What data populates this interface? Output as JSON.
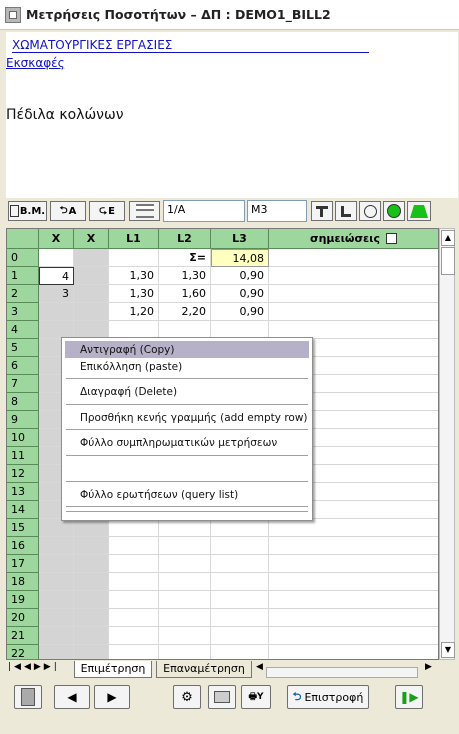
{
  "window": {
    "title": "Μετρήσεις Ποσοτήτων – ΔΠ : DEMO1_BILL2"
  },
  "info": {
    "category": "ΧΩΜΑΤΟΥΡΓΙΚΕΣ ΕΡΓΑΣΙΕΣ",
    "subcategory": "Εκσκαφές",
    "description": "Πέδιλα κολώνων"
  },
  "toolbar": {
    "bm_label": "B.M.",
    "a_label": "A",
    "e_label": "E",
    "code_value": "1/A",
    "unit_value": "M3"
  },
  "grid": {
    "columns": [
      "X",
      "X",
      "L1",
      "L2",
      "L3",
      "σημειώσεις"
    ],
    "sum_label": "Σ=",
    "sum_value": "14,08",
    "rows": [
      {
        "n": "0",
        "x1": "",
        "l1": "",
        "l2": "",
        "l3": ""
      },
      {
        "n": "1",
        "x1": "4",
        "l1": "1,30",
        "l2": "1,30",
        "l3": "0,90"
      },
      {
        "n": "2",
        "x1": "3",
        "l1": "1,30",
        "l2": "1,60",
        "l3": "0,90"
      },
      {
        "n": "3",
        "x1": "",
        "l1": "1,20",
        "l2": "2,20",
        "l3": "0,90"
      },
      {
        "n": "4"
      },
      {
        "n": "5"
      },
      {
        "n": "6"
      },
      {
        "n": "7"
      },
      {
        "n": "8"
      },
      {
        "n": "9"
      },
      {
        "n": "10"
      },
      {
        "n": "11"
      },
      {
        "n": "12"
      },
      {
        "n": "13"
      },
      {
        "n": "14"
      },
      {
        "n": "15"
      },
      {
        "n": "16"
      },
      {
        "n": "17"
      },
      {
        "n": "18"
      },
      {
        "n": "19"
      },
      {
        "n": "20"
      },
      {
        "n": "21"
      },
      {
        "n": "22"
      }
    ]
  },
  "context_menu": {
    "items": [
      "Αντιγραφή (Copy)",
      "Επικόλληση (paste)",
      "Διαγραφή (Delete)",
      "Προσθήκη κενής γραμμής (add empty row)",
      "Φύλλο συμπληρωματικών μετρήσεων",
      "Φύλλο ερωτήσεων (query list)"
    ]
  },
  "tabs": [
    "Επιμέτρηση",
    "Επαναμέτρηση"
  ],
  "bottom": {
    "return_label": "Επιστροφή"
  },
  "colors": {
    "grid_header": "#9ed79e",
    "sum_cell": "#ffffc0",
    "menu_highlight": "#b6b0c8",
    "link": "#1010c8"
  }
}
